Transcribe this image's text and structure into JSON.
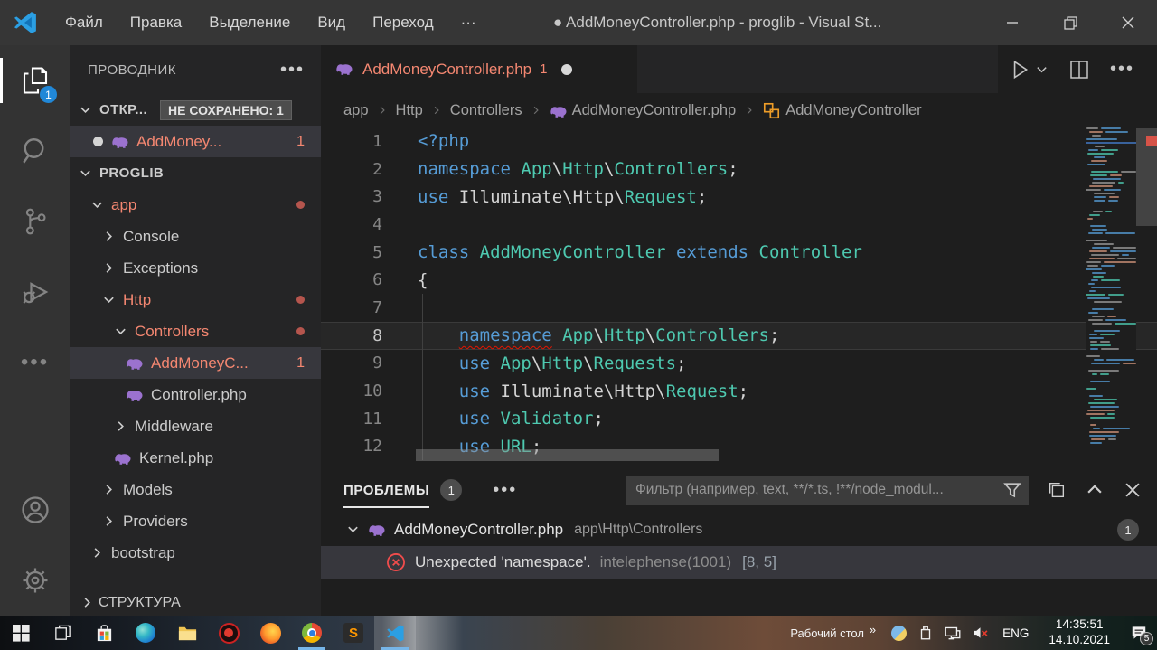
{
  "window": {
    "title": "● AddMoneyController.php - proglib - Visual St...",
    "menu": [
      "Файл",
      "Правка",
      "Выделение",
      "Вид",
      "Переход",
      "···"
    ]
  },
  "colors": {
    "accent": "#007acc",
    "error_red": "#f14c4c",
    "problem_name": "#f48771",
    "php_icon_purple": "#9b72cf",
    "class_icon_orange": "#ee9d28",
    "keyword_blue": "#569cd6",
    "type_green": "#4ec9b0"
  },
  "activity_bar": {
    "explorer_badge": "1"
  },
  "sidebar": {
    "title": "ПРОВОДНИК",
    "open_editors": {
      "label": "ОТКР...",
      "unsaved_badge": "НЕ СОХРАНЕНО: 1",
      "items": [
        {
          "label": "AddMoney...",
          "badge": "1"
        }
      ]
    },
    "tree": [
      {
        "label": "PROGLIB",
        "level": 0,
        "chevron": "down",
        "bold": true
      },
      {
        "label": "app",
        "level": 1,
        "chevron": "down",
        "red": true,
        "dot": true
      },
      {
        "label": "Console",
        "level": 2,
        "chevron": "right"
      },
      {
        "label": "Exceptions",
        "level": 2,
        "chevron": "right"
      },
      {
        "label": "Http",
        "level": 2,
        "chevron": "down",
        "red": true,
        "dot": true
      },
      {
        "label": "Controllers",
        "level": 3,
        "chevron": "down",
        "red": true,
        "dot": true
      },
      {
        "label": "AddMoneyC...",
        "level": 4,
        "icon": "php",
        "red": true,
        "badge": "1",
        "selected": true
      },
      {
        "label": "Controller.php",
        "level": 4,
        "icon": "php"
      },
      {
        "label": "Middleware",
        "level": 3,
        "chevron": "right"
      },
      {
        "label": "Kernel.php",
        "level": 3,
        "icon": "php"
      },
      {
        "label": "Models",
        "level": 2,
        "chevron": "right"
      },
      {
        "label": "Providers",
        "level": 2,
        "chevron": "right"
      },
      {
        "label": "bootstrap",
        "level": 1,
        "chevron": "right"
      }
    ],
    "outline_label": "СТРУКТУРА"
  },
  "editor": {
    "tab": {
      "name": "AddMoneyController.php",
      "badge": "1"
    },
    "breadcrumbs": [
      {
        "label": "app"
      },
      {
        "label": "Http"
      },
      {
        "label": "Controllers"
      },
      {
        "label": "AddMoneyController.php",
        "icon": "php"
      },
      {
        "label": "AddMoneyController",
        "icon": "class"
      }
    ],
    "code": {
      "lines": [
        {
          "n": 1,
          "tokens": [
            {
              "t": "<?php",
              "c": "k"
            }
          ]
        },
        {
          "n": 2,
          "tokens": [
            {
              "t": "namespace",
              "c": "k"
            },
            {
              "t": " ",
              "c": "p"
            },
            {
              "t": "App",
              "c": "t"
            },
            {
              "t": "\\",
              "c": "p"
            },
            {
              "t": "Http",
              "c": "t"
            },
            {
              "t": "\\",
              "c": "p"
            },
            {
              "t": "Controllers",
              "c": "t"
            },
            {
              "t": ";",
              "c": "p"
            }
          ]
        },
        {
          "n": 3,
          "tokens": [
            {
              "t": "use",
              "c": "k"
            },
            {
              "t": " Illuminate\\Http\\",
              "c": "p"
            },
            {
              "t": "Request",
              "c": "t"
            },
            {
              "t": ";",
              "c": "p"
            }
          ]
        },
        {
          "n": 4,
          "tokens": []
        },
        {
          "n": 5,
          "tokens": [
            {
              "t": "class",
              "c": "k"
            },
            {
              "t": " ",
              "c": "p"
            },
            {
              "t": "AddMoneyController",
              "c": "t"
            },
            {
              "t": " ",
              "c": "p"
            },
            {
              "t": "extends",
              "c": "k"
            },
            {
              "t": " ",
              "c": "p"
            },
            {
              "t": "Controller",
              "c": "t"
            }
          ]
        },
        {
          "n": 6,
          "tokens": [
            {
              "t": "{",
              "c": "p"
            }
          ]
        },
        {
          "n": 7,
          "tokens": [],
          "guide": true
        },
        {
          "n": 8,
          "current": true,
          "guide": true,
          "tokens": [
            {
              "t": "    ",
              "c": "p"
            },
            {
              "t": "namespace",
              "c": "k",
              "err": true
            },
            {
              "t": " ",
              "c": "p"
            },
            {
              "t": "App",
              "c": "t"
            },
            {
              "t": "\\",
              "c": "p"
            },
            {
              "t": "Http",
              "c": "t"
            },
            {
              "t": "\\",
              "c": "p"
            },
            {
              "t": "Controllers",
              "c": "t"
            },
            {
              "t": ";",
              "c": "p"
            }
          ]
        },
        {
          "n": 9,
          "guide": true,
          "tokens": [
            {
              "t": "    ",
              "c": "p"
            },
            {
              "t": "use",
              "c": "k"
            },
            {
              "t": " ",
              "c": "p"
            },
            {
              "t": "App",
              "c": "t"
            },
            {
              "t": "\\",
              "c": "p"
            },
            {
              "t": "Http",
              "c": "t"
            },
            {
              "t": "\\",
              "c": "p"
            },
            {
              "t": "Requests",
              "c": "t"
            },
            {
              "t": ";",
              "c": "p"
            }
          ]
        },
        {
          "n": 10,
          "guide": true,
          "tokens": [
            {
              "t": "    ",
              "c": "p"
            },
            {
              "t": "use",
              "c": "k"
            },
            {
              "t": " Illuminate\\Http\\",
              "c": "p"
            },
            {
              "t": "Request",
              "c": "t"
            },
            {
              "t": ";",
              "c": "p"
            }
          ]
        },
        {
          "n": 11,
          "guide": true,
          "tokens": [
            {
              "t": "    ",
              "c": "p"
            },
            {
              "t": "use",
              "c": "k"
            },
            {
              "t": " ",
              "c": "p"
            },
            {
              "t": "Validator",
              "c": "t"
            },
            {
              "t": ";",
              "c": "p"
            }
          ]
        },
        {
          "n": 12,
          "guide": true,
          "tokens": [
            {
              "t": "    ",
              "c": "p"
            },
            {
              "t": "use",
              "c": "k"
            },
            {
              "t": " ",
              "c": "p"
            },
            {
              "t": "URL",
              "c": "t"
            },
            {
              "t": ";",
              "c": "p"
            }
          ]
        }
      ]
    }
  },
  "panel": {
    "tab_label": "ПРОБЛЕМЫ",
    "tab_badge": "1",
    "filter_placeholder": "Фильтр (например, text, **/*.ts, !**/node_modul...",
    "file_row": {
      "name": "AddMoneyController.php",
      "path": "app\\Http\\Controllers",
      "badge": "1"
    },
    "error_row": {
      "message": "Unexpected 'namespace'.",
      "source": "intelephense(1001)",
      "position": "[8, 5]"
    }
  },
  "taskbar": {
    "desktop_label": "Рабочий стол",
    "expand_chevrons": "»",
    "language": "ENG",
    "time": "14:35:51",
    "date": "14.10.2021",
    "notification_count": "5"
  }
}
